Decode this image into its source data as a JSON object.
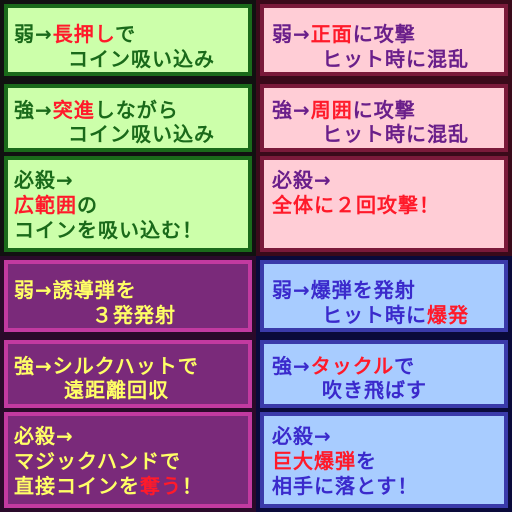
{
  "colors": {
    "green_bg": "#ccffaa",
    "green_border": "#1a6a1a",
    "green_text": "#1a6a1a",
    "pink_bg": "#ffcdd6",
    "pink_border": "#7a1a3a",
    "pink_text": "#6a1f8a",
    "purple_bg": "#7a2a7a",
    "purple_border": "#c23aa0",
    "purple_text": "#ffff66",
    "blue_bg": "#a8ccff",
    "blue_border": "#3a3aaa",
    "blue_text": "#3a2acc",
    "highlight": "#ff1a2a"
  },
  "panels": {
    "green": {
      "card1": {
        "l1a": "弱→",
        "l1h": "長押し",
        "l1b": "で",
        "l2": "コイン吸い込み"
      },
      "card2": {
        "l1a": "強→",
        "l1h": "突進",
        "l1b": "しながら",
        "l2": "コイン吸い込み"
      },
      "card3": {
        "l1": "必殺→",
        "l2h": "広範囲",
        "l2b": "の",
        "l3": "コインを吸い込む！"
      }
    },
    "pink": {
      "card1": {
        "l1a": "弱→",
        "l1h": "正面",
        "l1b": "に攻撃",
        "l2": "ヒット時に混乱"
      },
      "card2": {
        "l1a": "強→",
        "l1h": "周囲",
        "l1b": "に攻撃",
        "l2": "ヒット時に混乱"
      },
      "card3": {
        "l1": "必殺→",
        "l2h": "全体に２回攻撃！"
      }
    },
    "purple": {
      "card1": {
        "l1": "弱→誘導弾を",
        "l2": "３発発射"
      },
      "card2": {
        "l1": "強→シルクハットで",
        "l2": "遠距離回収"
      },
      "card3": {
        "l1": "必殺→",
        "l2": "マジックハンドで",
        "l3a": "直接コインを",
        "l3h": "奪う",
        "l3b": "！"
      }
    },
    "blue": {
      "card1": {
        "l1": "弱→爆弾を発射",
        "l2a": "ヒット時に",
        "l2h": "爆発"
      },
      "card2": {
        "l1a": "強→",
        "l1h": "タックル",
        "l1b": "で",
        "l2": "吹き飛ばす"
      },
      "card3": {
        "l1": "必殺→",
        "l2h": "巨大爆弾",
        "l2b": "を",
        "l3": "相手に落とす！"
      }
    }
  }
}
